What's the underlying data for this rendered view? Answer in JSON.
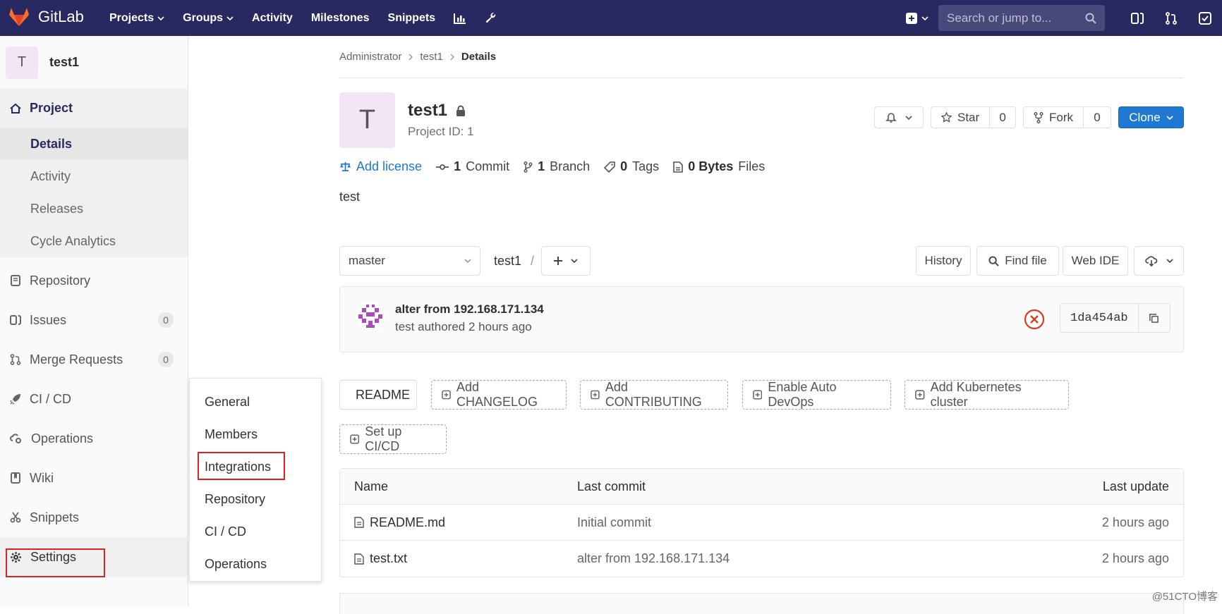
{
  "topbar": {
    "brand": "GitLab",
    "nav": [
      "Projects",
      "Groups",
      "Activity",
      "Milestones",
      "Snippets"
    ],
    "search_placeholder": "Search or jump to..."
  },
  "sidebar": {
    "project_initial": "T",
    "project_name": "test1",
    "project_label": "Project",
    "project_sub": [
      "Details",
      "Activity",
      "Releases",
      "Cycle Analytics"
    ],
    "items": [
      {
        "label": "Repository",
        "icon": "book-icon"
      },
      {
        "label": "Issues",
        "icon": "issues-icon",
        "badge": "0"
      },
      {
        "label": "Merge Requests",
        "icon": "merge-request-icon",
        "badge": "0"
      },
      {
        "label": "CI / CD",
        "icon": "rocket-icon"
      },
      {
        "label": "Operations",
        "icon": "cloud-gear-icon"
      },
      {
        "label": "Wiki",
        "icon": "wiki-icon"
      },
      {
        "label": "Snippets",
        "icon": "scissors-icon"
      },
      {
        "label": "Settings",
        "icon": "gear-icon"
      }
    ]
  },
  "settings_flyout": [
    "General",
    "Members",
    "Integrations",
    "Repository",
    "CI / CD",
    "Operations"
  ],
  "breadcrumb": [
    "Administrator",
    "test1",
    "Details"
  ],
  "project": {
    "initial": "T",
    "name": "test1",
    "id_text": "Project ID: 1",
    "star_label": "Star",
    "star_count": "0",
    "fork_label": "Fork",
    "fork_count": "0",
    "clone_label": "Clone",
    "add_license": "Add license",
    "commits_n": "1",
    "commits_label": "Commit",
    "branches_n": "1",
    "branches_label": "Branch",
    "tags_n": "0",
    "tags_label": "Tags",
    "files_n": "0 Bytes",
    "files_label": "Files",
    "description": "test"
  },
  "toolbar": {
    "branch": "master",
    "path_root": "test1",
    "path_sep": "/",
    "history": "History",
    "find_file": "Find file",
    "web_ide": "Web IDE"
  },
  "last_commit": {
    "title": "alter from 192.168.171.134",
    "author": "test",
    "meta": "authored 2 hours ago",
    "sha": "1da454ab"
  },
  "shortcuts": [
    "README",
    "Add CHANGELOG",
    "Add CONTRIBUTING",
    "Enable Auto DevOps",
    "Add Kubernetes cluster",
    "Set up CI/CD"
  ],
  "files_table": {
    "headers": [
      "Name",
      "Last commit",
      "Last update"
    ],
    "rows": [
      {
        "name": "README.md",
        "commit": "Initial commit",
        "updated": "2 hours ago"
      },
      {
        "name": "test.txt",
        "commit": "alter from 192.168.171.134",
        "updated": "2 hours ago"
      }
    ]
  },
  "watermark": "@51CTO博客",
  "colors": {
    "topbar": "#292961",
    "primary": "#1f78d1",
    "danger": "#db3b21",
    "highlight": "#dd2222"
  }
}
